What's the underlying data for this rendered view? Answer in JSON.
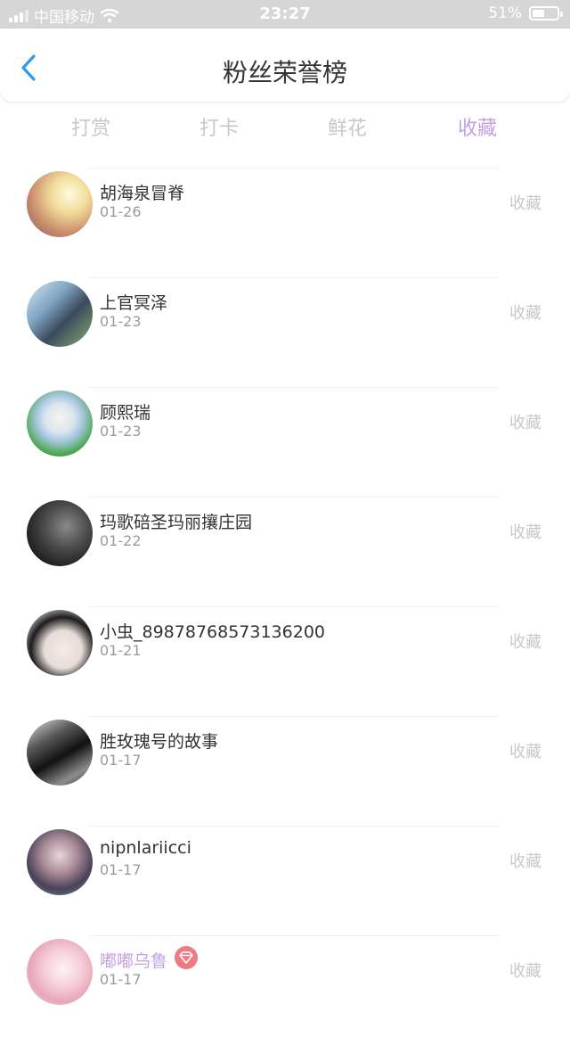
{
  "status_bar": {
    "carrier": "中国移动",
    "time": "23:27",
    "battery": "51%",
    "battery_level": 0.51
  },
  "header": {
    "title": "粉丝荣誉榜",
    "back_icon": "chevron-left-icon"
  },
  "tabs": [
    {
      "label": "打赏",
      "active": false
    },
    {
      "label": "打卡",
      "active": false
    },
    {
      "label": "鲜花",
      "active": false
    },
    {
      "label": "收藏",
      "active": true
    }
  ],
  "colors": {
    "accent": "#c3a0e0",
    "back": "#2d9cf0",
    "muted": "#c8c8c8",
    "vip_badge": "#f07a82",
    "status_bar": "#d6d6d6"
  },
  "fans": [
    {
      "name": "胡海泉冒脊",
      "date": "01-26",
      "action": "收藏"
    },
    {
      "name": "上官冥泽",
      "date": "01-23",
      "action": "收藏"
    },
    {
      "name": "顾熙瑞",
      "date": "01-23",
      "action": "收藏"
    },
    {
      "name": "玛歌碚圣玛丽攘庄园",
      "date": "01-22",
      "action": "收藏"
    },
    {
      "name": "小虫_89878768573136200",
      "date": "01-21",
      "action": "收藏"
    },
    {
      "name": "胜玫瑰号的故事",
      "date": "01-17",
      "action": "收藏"
    },
    {
      "name": "nipnlariicci",
      "date": "01-17",
      "action": "收藏"
    },
    {
      "name": "嘟嘟乌鲁",
      "date": "01-17",
      "action": "收藏",
      "vip": true,
      "badge_icon": "diamond-icon"
    }
  ]
}
